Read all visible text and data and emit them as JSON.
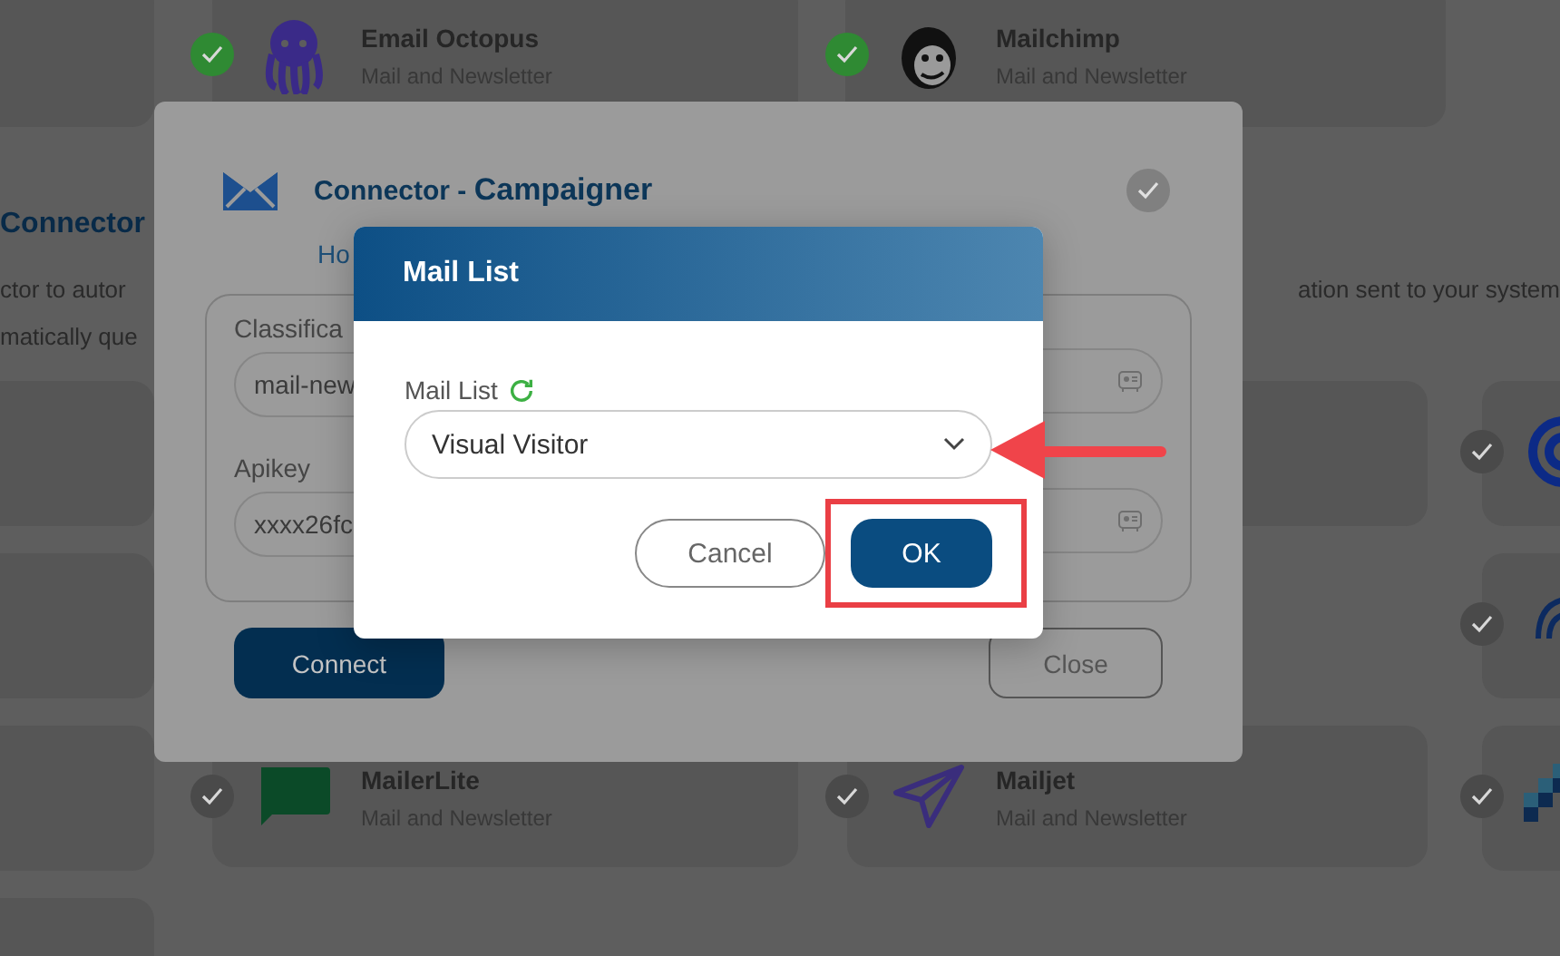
{
  "background": {
    "heading": "Connector",
    "text_lines": [
      "ctor to autor",
      "matically que"
    ],
    "right_text": "ation sent to your system",
    "cards": [
      {
        "kind": "octopus",
        "name": "Email Octopus",
        "category": "Mail and Newsletter",
        "color": "#2f8a33"
      },
      {
        "kind": "chimp",
        "name": "Mailchimp",
        "category": "Mail and Newsletter",
        "color": "#2f8a33"
      },
      {
        "kind": "rings",
        "color": "#4a4a4a"
      },
      {
        "kind": "wave",
        "color": "#4a4a4a"
      },
      {
        "kind": "speech",
        "name": "MailerLite",
        "category": "Mail and Newsletter",
        "color": "#4a4a4a"
      },
      {
        "kind": "plane",
        "name": "Mailjet",
        "category": "Mail and Newsletter",
        "color": "#4a4a4a"
      },
      {
        "kind": "squares",
        "color": "#4a4a4a"
      }
    ]
  },
  "connector_modal": {
    "title_prefix": "Connector - ",
    "title": "Campaigner",
    "link": "Ho",
    "fields": [
      {
        "label": "Classifica",
        "value": "mail-new"
      },
      {
        "label": "Apikey",
        "value": "xxxx26fc"
      }
    ],
    "buttons": [
      "Connect",
      "Close"
    ]
  },
  "mail_list_dialog": {
    "title": "Mail List",
    "field_label": "Mail List",
    "value": "Visual Visitor",
    "buttons": [
      "Cancel",
      "OK"
    ]
  }
}
